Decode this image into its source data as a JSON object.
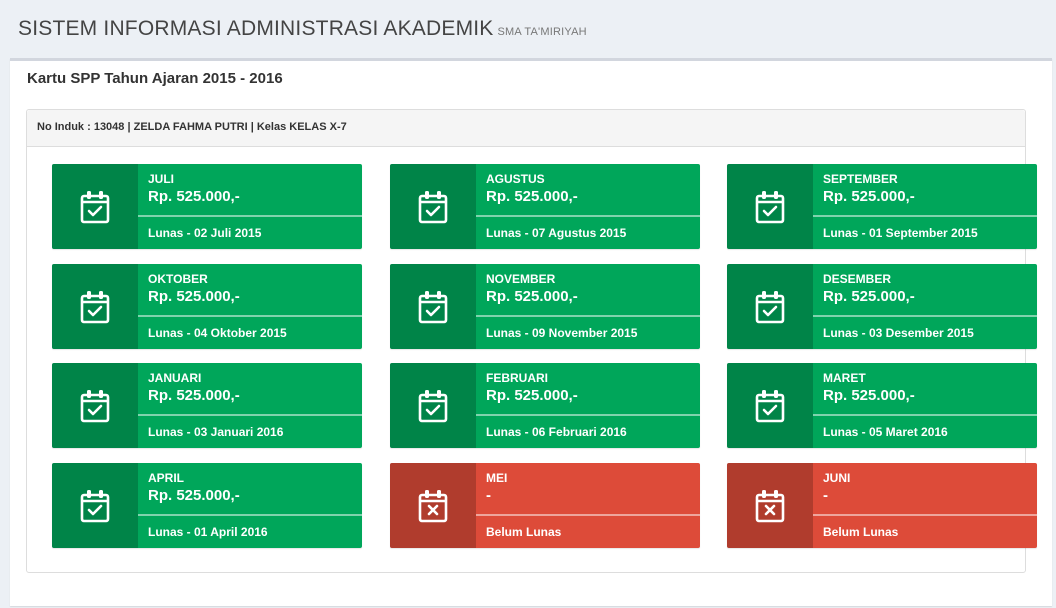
{
  "header": {
    "title": "SISTEM INFORMASI ADMINISTRASI AKADEMIK",
    "subtitle": "SMA TA'MIRIYAH"
  },
  "box": {
    "title": "Kartu SPP Tahun Ajaran 2015 - 2016"
  },
  "student": {
    "info": "No Induk : 13048 | ZELDA FAHMA PUTRI | Kelas KELAS X-7"
  },
  "colors": {
    "paid": "#00a65a",
    "unpaid": "#dd4b39"
  },
  "payments": [
    {
      "month": "JULI",
      "amount": "Rp. 525.000,-",
      "status": "Lunas - 02 Juli 2015",
      "paid": true,
      "icon": "calendar-check-icon"
    },
    {
      "month": "AGUSTUS",
      "amount": "Rp. 525.000,-",
      "status": "Lunas - 07 Agustus 2015",
      "paid": true,
      "icon": "calendar-check-icon"
    },
    {
      "month": "SEPTEMBER",
      "amount": "Rp. 525.000,-",
      "status": "Lunas - 01 September 2015",
      "paid": true,
      "icon": "calendar-check-icon"
    },
    {
      "month": "OKTOBER",
      "amount": "Rp. 525.000,-",
      "status": "Lunas - 04 Oktober 2015",
      "paid": true,
      "icon": "calendar-check-icon"
    },
    {
      "month": "NOVEMBER",
      "amount": "Rp. 525.000,-",
      "status": "Lunas - 09 November 2015",
      "paid": true,
      "icon": "calendar-check-icon"
    },
    {
      "month": "DESEMBER",
      "amount": "Rp. 525.000,-",
      "status": "Lunas - 03 Desember 2015",
      "paid": true,
      "icon": "calendar-check-icon"
    },
    {
      "month": "JANUARI",
      "amount": "Rp. 525.000,-",
      "status": "Lunas - 03 Januari 2016",
      "paid": true,
      "icon": "calendar-check-icon"
    },
    {
      "month": "FEBRUARI",
      "amount": "Rp. 525.000,-",
      "status": "Lunas - 06 Februari 2016",
      "paid": true,
      "icon": "calendar-check-icon"
    },
    {
      "month": "MARET",
      "amount": "Rp. 525.000,-",
      "status": "Lunas - 05 Maret 2016",
      "paid": true,
      "icon": "calendar-check-icon"
    },
    {
      "month": "APRIL",
      "amount": "Rp. 525.000,-",
      "status": "Lunas - 01 April 2016",
      "paid": true,
      "icon": "calendar-check-icon"
    },
    {
      "month": "MEI",
      "amount": "-",
      "status": "Belum Lunas",
      "paid": false,
      "icon": "calendar-times-icon"
    },
    {
      "month": "JUNI",
      "amount": "-",
      "status": "Belum Lunas",
      "paid": false,
      "icon": "calendar-times-icon"
    }
  ]
}
